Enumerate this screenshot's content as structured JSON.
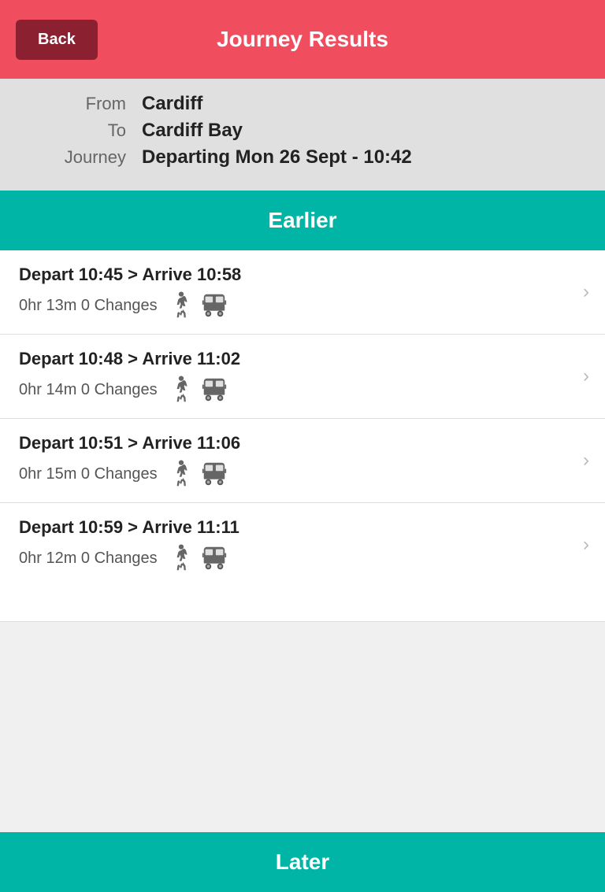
{
  "header": {
    "back_label": "Back",
    "title": "Journey Results"
  },
  "journey_info": {
    "from_label": "From",
    "from_value": "Cardiff",
    "to_label": "To",
    "to_value": "Cardiff Bay",
    "journey_label": "Journey",
    "journey_value": "Departing Mon 26 Sept - 10:42"
  },
  "earlier_label": "Earlier",
  "later_label": "Later",
  "results": [
    {
      "title": "Depart 10:45 > Arrive 10:58",
      "duration": "0hr 13m 0 Changes"
    },
    {
      "title": "Depart 10:48 > Arrive 11:02",
      "duration": "0hr 14m 0 Changes"
    },
    {
      "title": "Depart 10:51 > Arrive 11:06",
      "duration": "0hr 15m 0 Changes"
    },
    {
      "title": "Depart 10:59 > Arrive 11:11",
      "duration": "0hr 12m 0 Changes"
    }
  ]
}
